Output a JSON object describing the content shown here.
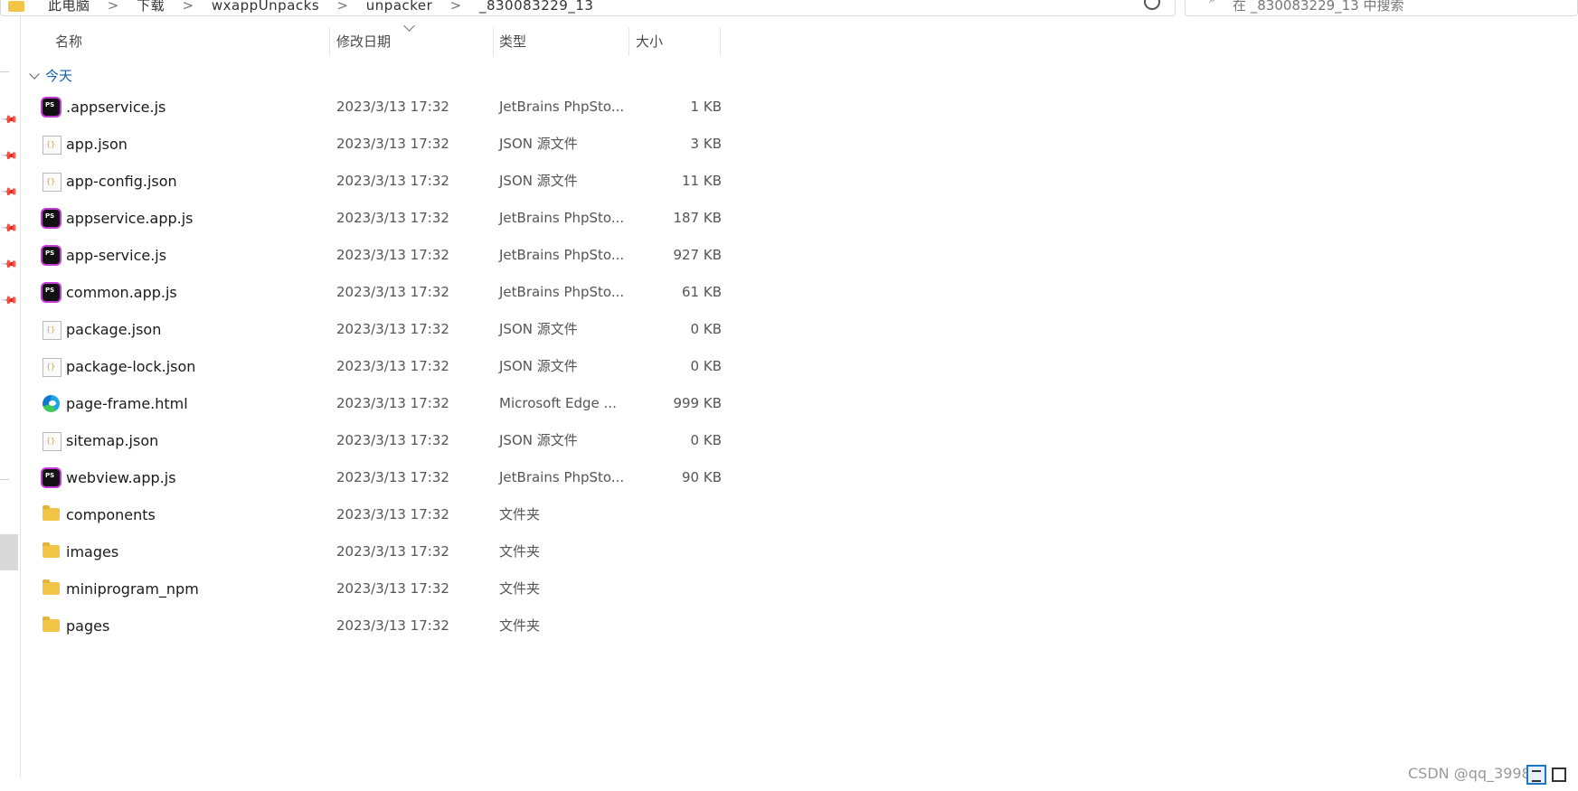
{
  "address_bar": {
    "crumbs": [
      "此电脑",
      "下载",
      "wxappUnpacks",
      "unpacker",
      "_830083229_13"
    ],
    "separator": ">"
  },
  "search": {
    "placeholder": "在 _830083229_13 中搜索"
  },
  "columns": {
    "name": "名称",
    "date": "修改日期",
    "type": "类型",
    "size": "大小"
  },
  "group_label": "今天",
  "files": [
    {
      "icon": "phpstorm-icon",
      "name": ".appservice.js",
      "date": "2023/3/13 17:32",
      "type": "JetBrains PhpSto...",
      "size": "1 KB"
    },
    {
      "icon": "json-file-icon",
      "name": "app.json",
      "date": "2023/3/13 17:32",
      "type": "JSON 源文件",
      "size": "3 KB"
    },
    {
      "icon": "json-file-icon",
      "name": "app-config.json",
      "date": "2023/3/13 17:32",
      "type": "JSON 源文件",
      "size": "11 KB"
    },
    {
      "icon": "phpstorm-icon",
      "name": "appservice.app.js",
      "date": "2023/3/13 17:32",
      "type": "JetBrains PhpSto...",
      "size": "187 KB"
    },
    {
      "icon": "phpstorm-icon",
      "name": "app-service.js",
      "date": "2023/3/13 17:32",
      "type": "JetBrains PhpSto...",
      "size": "927 KB"
    },
    {
      "icon": "phpstorm-icon",
      "name": "common.app.js",
      "date": "2023/3/13 17:32",
      "type": "JetBrains PhpSto...",
      "size": "61 KB"
    },
    {
      "icon": "json-file-icon",
      "name": "package.json",
      "date": "2023/3/13 17:32",
      "type": "JSON 源文件",
      "size": "0 KB"
    },
    {
      "icon": "json-file-icon",
      "name": "package-lock.json",
      "date": "2023/3/13 17:32",
      "type": "JSON 源文件",
      "size": "0 KB"
    },
    {
      "icon": "edge-icon",
      "name": "page-frame.html",
      "date": "2023/3/13 17:32",
      "type": "Microsoft Edge ...",
      "size": "999 KB"
    },
    {
      "icon": "json-file-icon",
      "name": "sitemap.json",
      "date": "2023/3/13 17:32",
      "type": "JSON 源文件",
      "size": "0 KB"
    },
    {
      "icon": "phpstorm-icon",
      "name": "webview.app.js",
      "date": "2023/3/13 17:32",
      "type": "JetBrains PhpSto...",
      "size": "90 KB"
    },
    {
      "icon": "folder-icon",
      "name": "components",
      "date": "2023/3/13 17:32",
      "type": "文件夹",
      "size": ""
    },
    {
      "icon": "folder-icon",
      "name": "images",
      "date": "2023/3/13 17:32",
      "type": "文件夹",
      "size": ""
    },
    {
      "icon": "folder-icon",
      "name": "miniprogram_npm",
      "date": "2023/3/13 17:32",
      "type": "文件夹",
      "size": ""
    },
    {
      "icon": "folder-icon",
      "name": "pages",
      "date": "2023/3/13 17:32",
      "type": "文件夹",
      "size": ""
    }
  ],
  "watermark": "CSDN @qq_3998",
  "colors": {
    "folder": "#f3c547",
    "group_header": "#1b5fa8",
    "selected_view": "#1b78c8"
  }
}
